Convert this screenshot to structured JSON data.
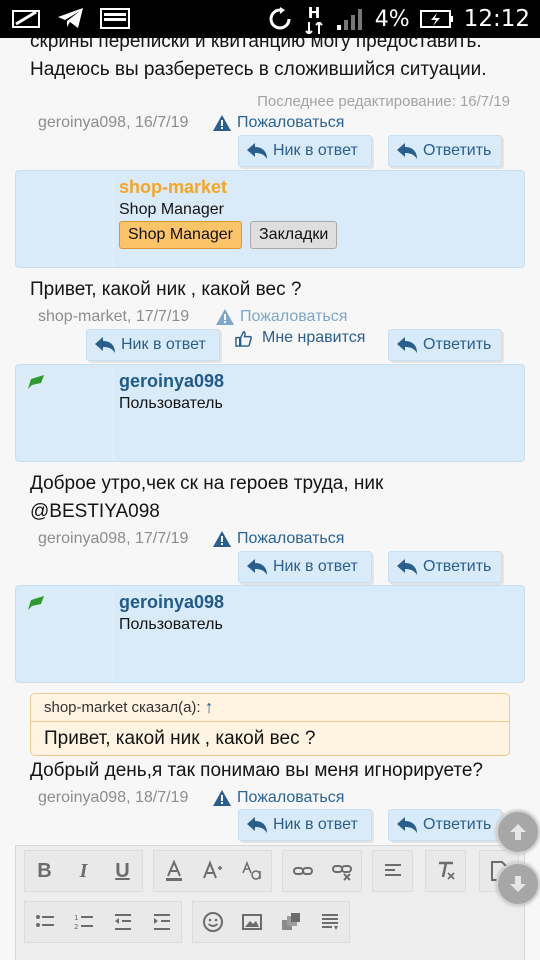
{
  "status_bar": {
    "battery_percent": "4%",
    "time": "12:12",
    "network_label": "H"
  },
  "posts": {
    "p1": {
      "text_line1": "скрины переписки и квитанцию могу предоставить.",
      "text_line2": "Надеюсь вы разберетесь в сложившийся ситуации.",
      "edited": "Последнее редактирование: 16/7/19",
      "meta": "geroinya098, 16/7/19",
      "report": "Пожаловаться"
    },
    "p2": {
      "author": "shop-market",
      "role": "Shop Manager",
      "tag1": "Shop Manager",
      "tag2": "Закладки",
      "text": "Привет, какой ник , какой вес ?",
      "meta": "shop-market, 17/7/19",
      "report": "Пожаловаться",
      "like": "Мне нравится"
    },
    "p3": {
      "author": "geroinya098",
      "role": "Пользователь",
      "text_line1": "Доброе утро,чек ск на героев труда, ник",
      "text_line2": "@BESTIYA098",
      "meta": "geroinya098, 17/7/19",
      "report": "Пожаловаться"
    },
    "p4": {
      "author": "geroinya098",
      "role": "Пользователь",
      "quote_head": "shop-market сказал(а):",
      "quote_arrow": "↑",
      "quote_text": "Привет, какой ник , какой вес ?",
      "text": "Добрый день,я так понимаю вы меня игнорируете?",
      "meta": "geroinya098, 18/7/19",
      "report": "Пожаловаться"
    }
  },
  "buttons": {
    "nick_reply": "Ник в ответ",
    "reply": "Ответить"
  },
  "colors": {
    "author_orange": "#f5a623",
    "author_blue": "#215a8c",
    "link_blue": "#2a6496"
  }
}
